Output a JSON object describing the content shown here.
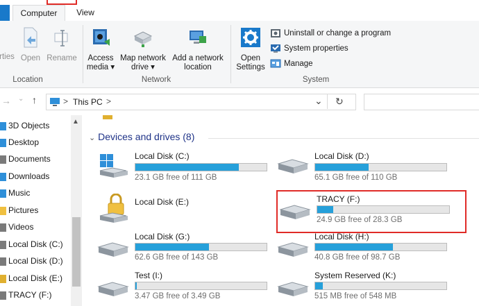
{
  "tabs": {
    "computer": "Computer",
    "view": "View"
  },
  "ribbon": {
    "location": {
      "properties": "rties",
      "open": "Open",
      "rename": "Rename",
      "group": "Location"
    },
    "network": {
      "access_media_1": "Access",
      "access_media_2": "media ▾",
      "map_drive_1": "Map network",
      "map_drive_2": "drive ▾",
      "add_location_1": "Add a network",
      "add_location_2": "location",
      "group": "Network"
    },
    "system": {
      "open_settings_1": "Open",
      "open_settings_2": "Settings",
      "uninstall": "Uninstall or change a program",
      "system_properties": "System properties",
      "manage": "Manage",
      "group": "System"
    }
  },
  "address": {
    "path": "This PC",
    "sep1": ">",
    "sep2": ">",
    "refresh_icon": "refresh-icon",
    "dropdown_icon": "chevron-down-icon"
  },
  "nav": {
    "items": [
      {
        "label": "3D Objects",
        "color": "#2e8fd9"
      },
      {
        "label": "Desktop",
        "color": "#2e8fd9"
      },
      {
        "label": "Documents",
        "color": "#7a7a7a"
      },
      {
        "label": "Downloads",
        "color": "#2e8fd9"
      },
      {
        "label": "Music",
        "color": "#2e8fd9"
      },
      {
        "label": "Pictures",
        "color": "#f0c040"
      },
      {
        "label": "Videos",
        "color": "#7a7a7a"
      },
      {
        "label": "Local Disk (C:)",
        "color": "#7a7a7a"
      },
      {
        "label": "Local Disk (D:)",
        "color": "#7a7a7a"
      },
      {
        "label": "Local Disk (E:)",
        "color": "#e0b030"
      },
      {
        "label": "TRACY (F:)",
        "color": "#7a7a7a"
      }
    ]
  },
  "content": {
    "section_title": "Devices and drives (8)",
    "drives": [
      {
        "name": "Local Disk (C:)",
        "free": "23.1 GB free of 111 GB",
        "used_fraction": 0.79,
        "icon": "windows-drive-icon"
      },
      {
        "name": "Local Disk (D:)",
        "free": "65.1 GB free of 110 GB",
        "used_fraction": 0.41,
        "icon": "drive-icon"
      },
      {
        "name": "Local Disk (E:)",
        "free": "",
        "used_fraction": null,
        "icon": "locked-drive-icon"
      },
      {
        "name": "TRACY (F:)",
        "free": "24.9 GB free of 28.3 GB",
        "used_fraction": 0.12,
        "icon": "drive-icon"
      },
      {
        "name": "Local Disk (G:)",
        "free": "62.6 GB free of 143 GB",
        "used_fraction": 0.56,
        "icon": "drive-icon"
      },
      {
        "name": "Local Disk (H:)",
        "free": "40.8 GB free of 98.7 GB",
        "used_fraction": 0.59,
        "icon": "drive-icon"
      },
      {
        "name": "Test (I:)",
        "free": "3.47 GB free of 3.49 GB",
        "used_fraction": 0.01,
        "icon": "drive-icon"
      },
      {
        "name": "System Reserved (K:)",
        "free": "515 MB free of 548 MB",
        "used_fraction": 0.06,
        "icon": "drive-icon"
      }
    ]
  },
  "colors": {
    "accent": "#1979ca",
    "bar_fill": "#26a0da",
    "highlight": "#e02b27"
  }
}
